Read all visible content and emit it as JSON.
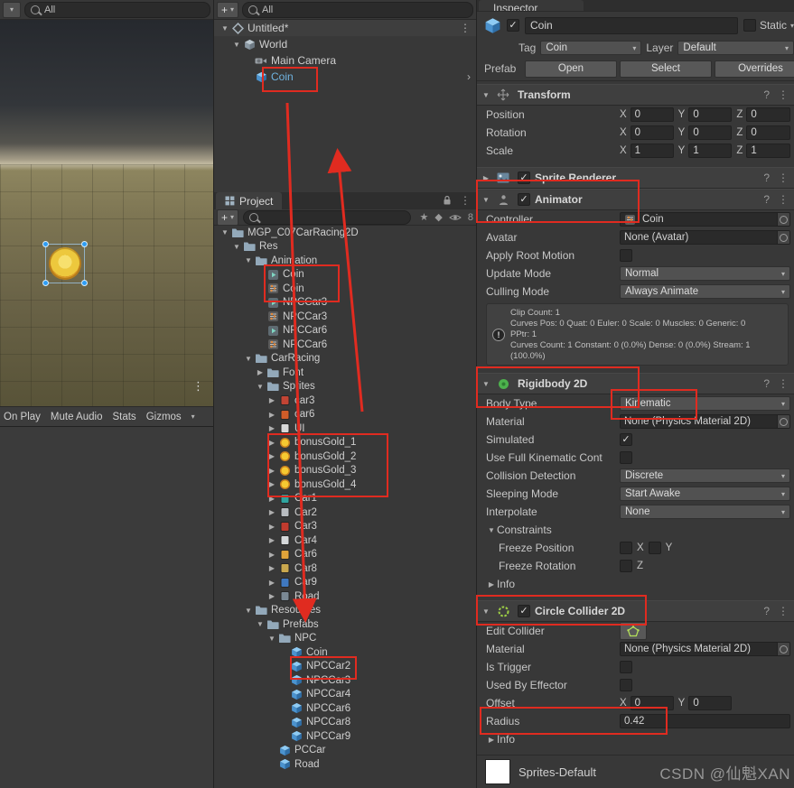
{
  "scene_view": {
    "search_text": "All",
    "game_toolbar_items": [
      "On Play",
      "Mute Audio",
      "Stats",
      "Gizmos"
    ]
  },
  "hierarchy": {
    "add_button_label": "+",
    "search_text": "All",
    "items": [
      {
        "label": "Untitled*",
        "depth": 0,
        "arrow": "open",
        "icon": "scene-icon",
        "header": true,
        "right_icon": "kebab-menu-icon"
      },
      {
        "label": "World",
        "depth": 1,
        "arrow": "open",
        "icon": "gameobject-icon"
      },
      {
        "label": "Main Camera",
        "depth": 2,
        "icon": "camera-icon"
      },
      {
        "label": "Coin",
        "depth": 2,
        "icon": "prefab-icon",
        "prefab": true,
        "right_icon": "prefab-chevron-icon"
      }
    ]
  },
  "project": {
    "tab_label": "Project",
    "add_button_label": "+",
    "hidden_count": "8",
    "tree": [
      {
        "label": "MGP_C07CarRacing2D",
        "depth": 0,
        "arrow": "open",
        "icon": "folder-icon"
      },
      {
        "label": "Res",
        "depth": 1,
        "arrow": "open",
        "icon": "folder-icon"
      },
      {
        "label": "Animation",
        "depth": 2,
        "arrow": "open",
        "icon": "folder-icon"
      },
      {
        "label": "Coin",
        "depth": 3,
        "icon": "animclip-icon"
      },
      {
        "label": "Coin",
        "depth": 3,
        "icon": "animctrl-icon"
      },
      {
        "label": "NPCCar3",
        "depth": 3,
        "icon": "animclip-icon"
      },
      {
        "label": "NPCCar3",
        "depth": 3,
        "icon": "animctrl-icon"
      },
      {
        "label": "NPCCar6",
        "depth": 3,
        "icon": "animclip-icon"
      },
      {
        "label": "NPCCar6",
        "depth": 3,
        "icon": "animctrl-icon"
      },
      {
        "label": "CarRacing",
        "depth": 2,
        "arrow": "open",
        "icon": "folder-icon"
      },
      {
        "label": "Font",
        "depth": 3,
        "arrow": "closed",
        "icon": "folder-icon"
      },
      {
        "label": "Sprites",
        "depth": 3,
        "arrow": "open",
        "icon": "folder-icon"
      },
      {
        "label": "car3",
        "depth": 4,
        "arrow": "closed",
        "icon": "sprite-icon",
        "color": "#c24434"
      },
      {
        "label": "car6",
        "depth": 4,
        "arrow": "closed",
        "icon": "sprite-icon",
        "color": "#cf5c28"
      },
      {
        "label": "UI",
        "depth": 4,
        "arrow": "closed",
        "icon": "sprite-icon",
        "color": "#d8d8d8"
      },
      {
        "label": "bonusGold_1",
        "depth": 4,
        "arrow": "closed",
        "icon": "gold-icon",
        "color": "#f6c931"
      },
      {
        "label": "bonusGold_2",
        "depth": 4,
        "arrow": "closed",
        "icon": "gold-icon",
        "color": "#f6c931"
      },
      {
        "label": "bonusGold_3",
        "depth": 4,
        "arrow": "closed",
        "icon": "gold-icon",
        "color": "#f6c931"
      },
      {
        "label": "bonusGold_4",
        "depth": 4,
        "arrow": "closed",
        "icon": "gold-icon",
        "color": "#f6c931"
      },
      {
        "label": "Car1",
        "depth": 4,
        "arrow": "closed",
        "icon": "sprite-icon",
        "color": "#2fa49f"
      },
      {
        "label": "Car2",
        "depth": 4,
        "arrow": "closed",
        "icon": "sprite-icon",
        "color": "#b8bcc0"
      },
      {
        "label": "Car3",
        "depth": 4,
        "arrow": "closed",
        "icon": "sprite-icon",
        "color": "#c23b2e"
      },
      {
        "label": "Car4",
        "depth": 4,
        "arrow": "closed",
        "icon": "sprite-icon",
        "color": "#d5d8da"
      },
      {
        "label": "Car6",
        "depth": 4,
        "arrow": "closed",
        "icon": "sprite-icon",
        "color": "#e0a33a"
      },
      {
        "label": "Car8",
        "depth": 4,
        "arrow": "closed",
        "icon": "sprite-icon",
        "color": "#caa84e"
      },
      {
        "label": "Car9",
        "depth": 4,
        "arrow": "closed",
        "icon": "sprite-icon",
        "color": "#3f78c0"
      },
      {
        "label": "Road",
        "depth": 4,
        "arrow": "closed",
        "icon": "sprite-icon",
        "color": "#7a8894"
      },
      {
        "label": "Resources",
        "depth": 2,
        "arrow": "open",
        "icon": "folder-icon"
      },
      {
        "label": "Prefabs",
        "depth": 3,
        "arrow": "open",
        "icon": "folder-icon"
      },
      {
        "label": "NPC",
        "depth": 4,
        "arrow": "open",
        "icon": "folder-icon"
      },
      {
        "label": "Coin",
        "depth": 5,
        "icon": "prefab-icon"
      },
      {
        "label": "NPCCar2",
        "depth": 5,
        "icon": "prefab-icon"
      },
      {
        "label": "NPCCar3",
        "depth": 5,
        "icon": "prefab-icon"
      },
      {
        "label": "NPCCar4",
        "depth": 5,
        "icon": "prefab-icon"
      },
      {
        "label": "NPCCar6",
        "depth": 5,
        "icon": "prefab-icon"
      },
      {
        "label": "NPCCar8",
        "depth": 5,
        "icon": "prefab-icon"
      },
      {
        "label": "NPCCar9",
        "depth": 5,
        "icon": "prefab-icon"
      },
      {
        "label": "PCCar",
        "depth": 4,
        "icon": "prefab-icon"
      },
      {
        "label": "Road",
        "depth": 4,
        "icon": "prefab-icon"
      }
    ]
  },
  "inspector": {
    "tab_label": "Inspector",
    "header": {
      "name": "Coin",
      "static_label": "Static",
      "tag_label": "Tag",
      "tag_value": "Coin",
      "layer_label": "Layer",
      "layer_value": "Default",
      "prefab_label": "Prefab",
      "open_button": "Open",
      "select_button": "Select",
      "overrides_button": "Overrides"
    },
    "components": [
      {
        "title": "Transform",
        "icon": "transform-icon",
        "expanded": true,
        "rows": [
          {
            "type": "vec3",
            "label": "Position",
            "values": [
              {
                "axis": "X",
                "v": "0"
              },
              {
                "axis": "Y",
                "v": "0"
              },
              {
                "axis": "Z",
                "v": "0"
              }
            ]
          },
          {
            "type": "vec3",
            "label": "Rotation",
            "values": [
              {
                "axis": "X",
                "v": "0"
              },
              {
                "axis": "Y",
                "v": "0"
              },
              {
                "axis": "Z",
                "v": "0"
              }
            ]
          },
          {
            "type": "vec3",
            "label": "Scale",
            "values": [
              {
                "axis": "X",
                "v": "1"
              },
              {
                "axis": "Y",
                "v": "1"
              },
              {
                "axis": "Z",
                "v": "1"
              }
            ]
          }
        ]
      },
      {
        "title": "Sprite Renderer",
        "icon": "sprite-renderer-icon",
        "expanded": false,
        "enabled": true,
        "rows": []
      },
      {
        "title": "Animator",
        "icon": "animator-icon",
        "expanded": true,
        "enabled": true,
        "rows": [
          {
            "type": "obj",
            "label": "Controller",
            "value": "Coin",
            "objicon": "animctrl-icon"
          },
          {
            "type": "obj",
            "label": "Avatar",
            "value": "None (Avatar)"
          },
          {
            "type": "check",
            "label": "Apply Root Motion",
            "checked": false
          },
          {
            "type": "dropdown",
            "label": "Update Mode",
            "value": "Normal"
          },
          {
            "type": "dropdown",
            "label": "Culling Mode",
            "value": "Always Animate"
          },
          {
            "type": "infobox",
            "label": "animator-info",
            "lines": [
              "Clip Count: 1",
              "Curves Pos: 0 Quat: 0 Euler: 0 Scale: 0 Muscles: 0 Generic: 0",
              "PPtr: 1",
              "Curves Count: 1 Constant: 0 (0.0%) Dense: 0 (0.0%) Stream: 1 (100.0%)"
            ]
          }
        ]
      },
      {
        "title": "Rigidbody 2D",
        "icon": "rigidbody2d-icon",
        "expanded": true,
        "rows": [
          {
            "type": "dropdown",
            "label": "Body Type",
            "value": "Kinematic"
          },
          {
            "type": "obj",
            "label": "Material",
            "value": "None (Physics Material 2D)"
          },
          {
            "type": "check",
            "label": "Simulated",
            "checked": true
          },
          {
            "type": "check",
            "label": "Use Full Kinematic Cont",
            "checked": false
          },
          {
            "type": "dropdown",
            "label": "Collision Detection",
            "value": "Discrete"
          },
          {
            "type": "dropdown",
            "label": "Sleeping Mode",
            "value": "Start Awake"
          },
          {
            "type": "dropdown",
            "label": "Interpolate",
            "value": "None"
          },
          {
            "type": "foldout",
            "label": "Constraints",
            "expanded": true
          },
          {
            "type": "axischecks",
            "label": "Freeze Position",
            "indent": 1,
            "axes": [
              {
                "axis": "X",
                "checked": false
              },
              {
                "axis": "Y",
                "checked": false
              }
            ]
          },
          {
            "type": "axischecks",
            "label": "Freeze Rotation",
            "indent": 1,
            "axes": [
              {
                "axis": "Z",
                "checked": false
              }
            ]
          },
          {
            "type": "foldout",
            "label": "Info",
            "expanded": false
          }
        ]
      },
      {
        "title": "Circle Collider 2D",
        "icon": "circle-collider-icon",
        "expanded": true,
        "enabled": true,
        "rows": [
          {
            "type": "editcollider",
            "label": "Edit Collider"
          },
          {
            "type": "obj",
            "label": "Material",
            "value": "None (Physics Material 2D)"
          },
          {
            "type": "check",
            "label": "Is Trigger",
            "checked": false
          },
          {
            "type": "check",
            "label": "Used By Effector",
            "checked": false
          },
          {
            "type": "vec2",
            "label": "Offset",
            "values": [
              {
                "axis": "X",
                "v": "0"
              },
              {
                "axis": "Y",
                "v": "0"
              }
            ]
          },
          {
            "type": "field",
            "label": "Radius",
            "value": "0.42"
          },
          {
            "type": "foldout",
            "label": "Info",
            "expanded": false
          }
        ]
      }
    ],
    "material_footer": "Sprites-Default",
    "watermark": "CSDN @仙魁XAN"
  }
}
